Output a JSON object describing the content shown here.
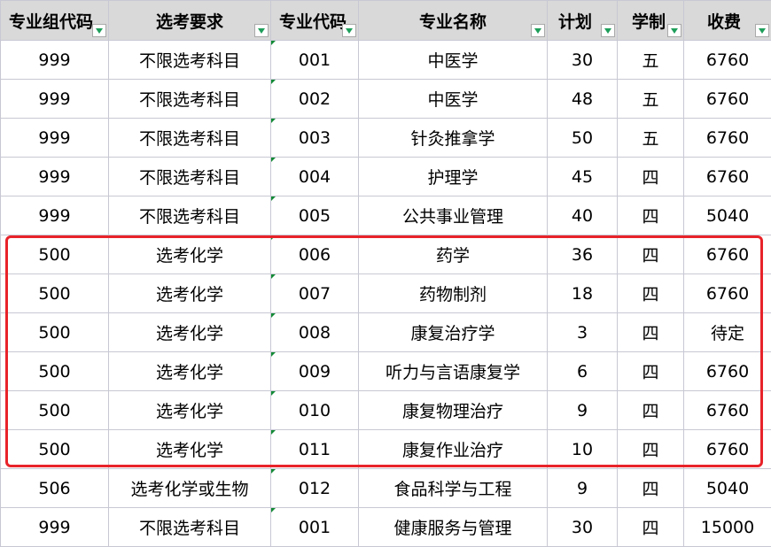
{
  "headers": [
    {
      "label": "专业组代码"
    },
    {
      "label": "选考要求"
    },
    {
      "label": "专业代码"
    },
    {
      "label": "专业名称"
    },
    {
      "label": "计划"
    },
    {
      "label": "学制"
    },
    {
      "label": "收费"
    }
  ],
  "rows": [
    [
      "999",
      "不限选考科目",
      "001",
      "中医学",
      "30",
      "五",
      "6760"
    ],
    [
      "999",
      "不限选考科目",
      "002",
      "中医学",
      "48",
      "五",
      "6760"
    ],
    [
      "999",
      "不限选考科目",
      "003",
      "针灸推拿学",
      "50",
      "五",
      "6760"
    ],
    [
      "999",
      "不限选考科目",
      "004",
      "护理学",
      "45",
      "四",
      "6760"
    ],
    [
      "999",
      "不限选考科目",
      "005",
      "公共事业管理",
      "40",
      "四",
      "5040"
    ],
    [
      "500",
      "选考化学",
      "006",
      "药学",
      "36",
      "四",
      "6760"
    ],
    [
      "500",
      "选考化学",
      "007",
      "药物制剂",
      "18",
      "四",
      "6760"
    ],
    [
      "500",
      "选考化学",
      "008",
      "康复治疗学",
      "3",
      "四",
      "待定"
    ],
    [
      "500",
      "选考化学",
      "009",
      "听力与言语康复学",
      "6",
      "四",
      "6760"
    ],
    [
      "500",
      "选考化学",
      "010",
      "康复物理治疗",
      "9",
      "四",
      "6760"
    ],
    [
      "500",
      "选考化学",
      "011",
      "康复作业治疗",
      "10",
      "四",
      "6760"
    ],
    [
      "506",
      "选考化学或生物",
      "012",
      "食品科学与工程",
      "9",
      "四",
      "5040"
    ],
    [
      "999",
      "不限选考科目",
      "001",
      "健康服务与管理",
      "30",
      "四",
      "15000"
    ]
  ],
  "highlight": {
    "first_row": 6,
    "last_row": 11,
    "color": "#e8232a"
  },
  "colors": {
    "header_bg": "#d9d9d9",
    "grid": "#c8c8d4",
    "filter_arrow": "#1e9e5a",
    "text_marker": "#138a36"
  }
}
